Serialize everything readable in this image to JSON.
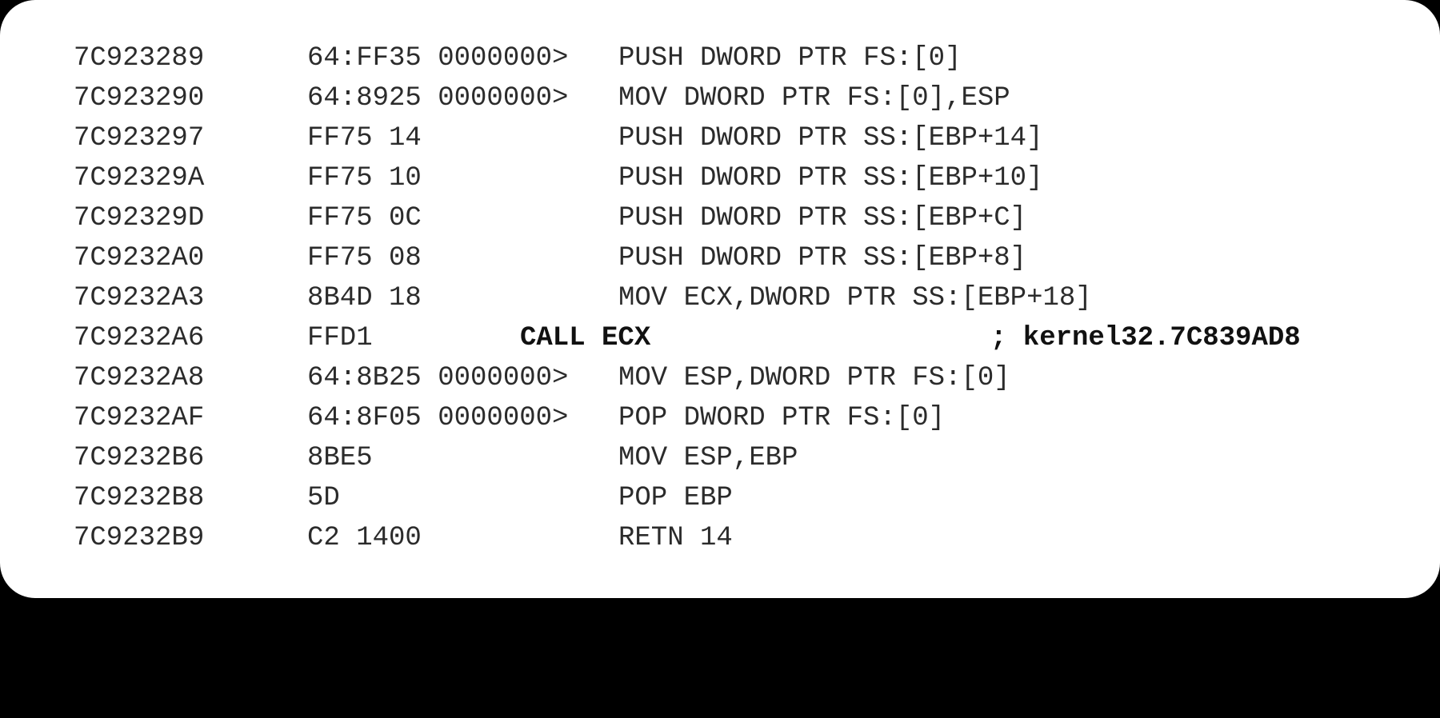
{
  "disassembly": {
    "rows": [
      {
        "address": "7C923289",
        "hex": "64:FF35 0000000>",
        "instruction": "PUSH DWORD PTR FS:[0]",
        "comment": ""
      },
      {
        "address": "7C923290",
        "hex": "64:8925 0000000>",
        "instruction": "MOV DWORD PTR FS:[0],ESP",
        "comment": ""
      },
      {
        "address": "7C923297",
        "hex": "FF75 14",
        "instruction": "PUSH DWORD PTR SS:[EBP+14]",
        "comment": ""
      },
      {
        "address": "7C92329A",
        "hex": "FF75 10",
        "instruction": "PUSH DWORD PTR SS:[EBP+10]",
        "comment": ""
      },
      {
        "address": "7C92329D",
        "hex": "FF75 0C",
        "instruction": "PUSH DWORD PTR SS:[EBP+C]",
        "comment": ""
      },
      {
        "address": "7C9232A0",
        "hex": "FF75 08",
        "instruction": "PUSH DWORD PTR SS:[EBP+8]",
        "comment": ""
      },
      {
        "address": "7C9232A3",
        "hex": "8B4D 18",
        "instruction": "MOV ECX,DWORD PTR SS:[EBP+18]",
        "comment": ""
      },
      {
        "address": "7C9232A6",
        "hex": "FFD1",
        "instruction": "CALL ECX",
        "comment": "; kernel32.7C839AD8",
        "highlighted": true
      },
      {
        "address": "7C9232A8",
        "hex": "64:8B25 0000000>",
        "instruction": "MOV ESP,DWORD PTR FS:[0]",
        "comment": ""
      },
      {
        "address": "7C9232AF",
        "hex": "64:8F05 0000000>",
        "instruction": "POP DWORD PTR FS:[0]",
        "comment": ""
      },
      {
        "address": "7C9232B6",
        "hex": "8BE5",
        "instruction": "MOV ESP,EBP",
        "comment": ""
      },
      {
        "address": "7C9232B8",
        "hex": "5D",
        "instruction": "POP EBP",
        "comment": ""
      },
      {
        "address": "7C9232B9",
        "hex": "C2 1400",
        "instruction": "RETN 14",
        "comment": ""
      }
    ]
  }
}
